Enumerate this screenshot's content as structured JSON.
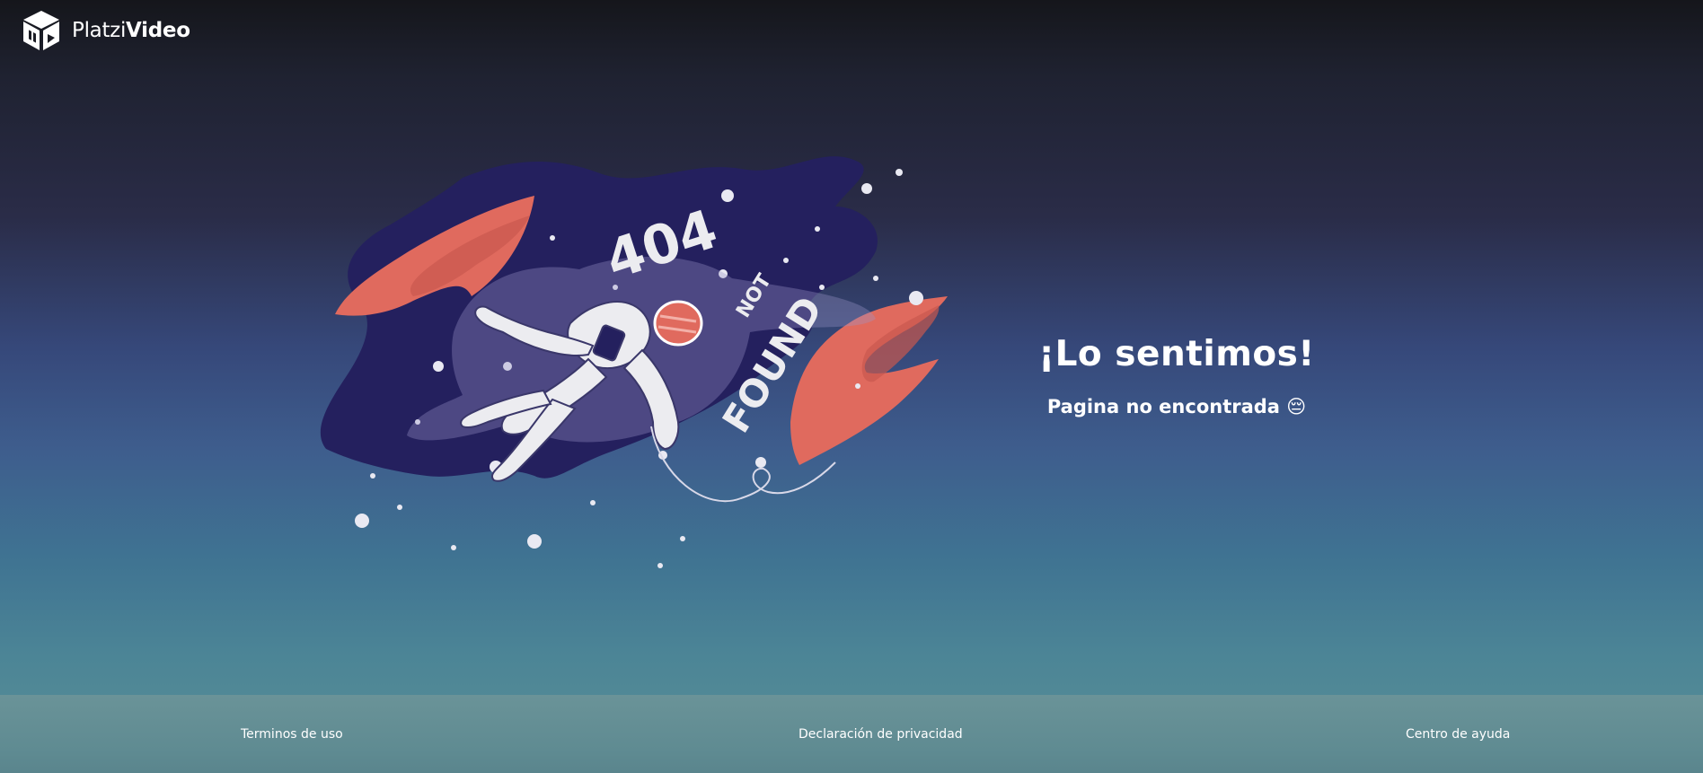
{
  "header": {
    "brand_light": "Platzi",
    "brand_bold": "Video",
    "logo_icon": "cube-logo-icon"
  },
  "illustration": {
    "text_404": "404",
    "text_not": "NOT",
    "text_found": "FOUND",
    "icon": "astronaut-illustration"
  },
  "message": {
    "title": "¡Lo sentimos!",
    "subtitle": "Pagina no encontrada 😔"
  },
  "footer": {
    "links": [
      "Terminos de uso",
      "Declaración de privacidad",
      "Centro de ayuda"
    ]
  },
  "colors": {
    "space_blob": "#24205e",
    "planet": "#e06a5e",
    "planet_shadow": "#c9584f",
    "astronaut": "#ececf0",
    "footer_bg": "#6a9398"
  }
}
